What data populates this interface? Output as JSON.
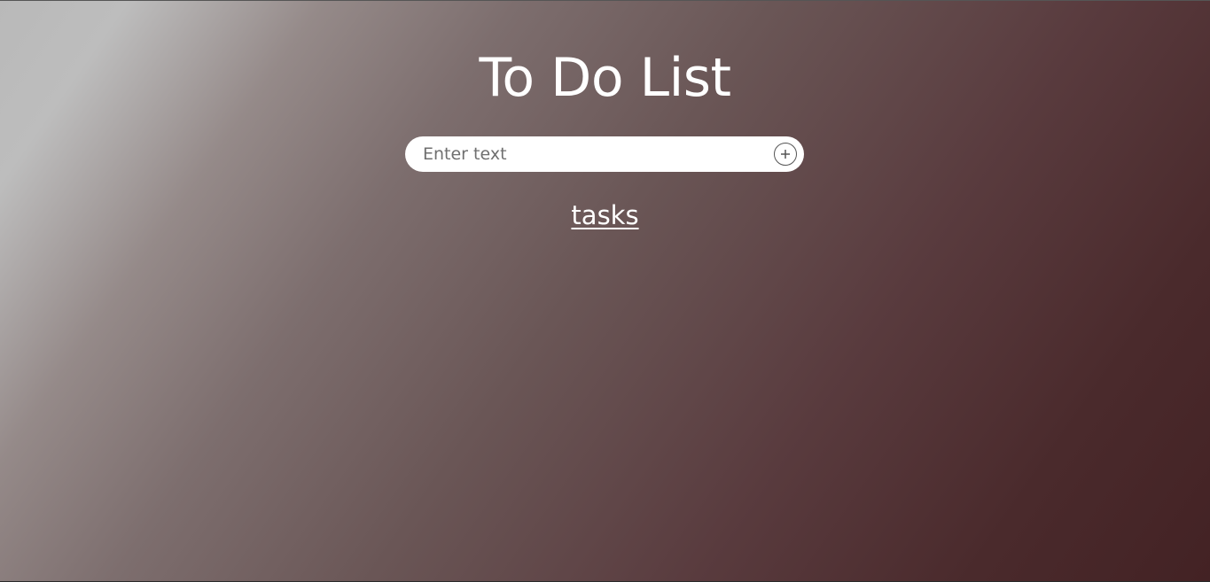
{
  "header": {
    "title": "To Do List"
  },
  "task_input": {
    "placeholder": "Enter text",
    "value": "",
    "add_icon": "plus-circle-icon"
  },
  "tasks_section": {
    "label": "tasks"
  },
  "colors": {
    "gradient_start": "#bdbdbd",
    "gradient_end": "#432224",
    "title_text": "#ffffff",
    "input_background": "#ffffff"
  }
}
